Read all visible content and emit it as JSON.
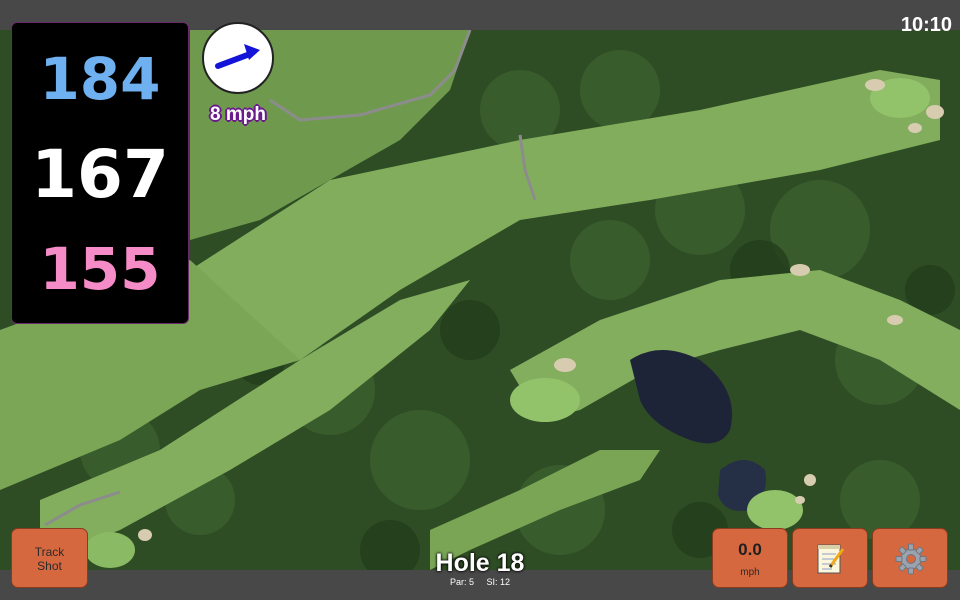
{
  "status_bar": {
    "time": "10:10"
  },
  "distances": {
    "back": "184",
    "middle": "167",
    "front": "155"
  },
  "wind": {
    "speed_label": "8 mph",
    "direction_icon": "arrow-icon",
    "arrow_color": "#1414d8"
  },
  "buttons": {
    "track_shot_line1": "Track",
    "track_shot_line2": "Shot",
    "speed_value": "0.0",
    "speed_unit": "mph",
    "notes_icon": "notepad-icon",
    "settings_icon": "gear-icon"
  },
  "hole": {
    "title": "Hole 18",
    "par_label": "Par: 5",
    "si_label": "SI: 12"
  },
  "colors": {
    "distance_back": "#6fb1f0",
    "distance_middle": "#ffffff",
    "distance_front": "#f58cc8",
    "button": "#d5683e",
    "fairway": "#7faa5a",
    "trees": "#2c4a22",
    "water": "#1d2438",
    "bunker": "#d8ccb0"
  }
}
